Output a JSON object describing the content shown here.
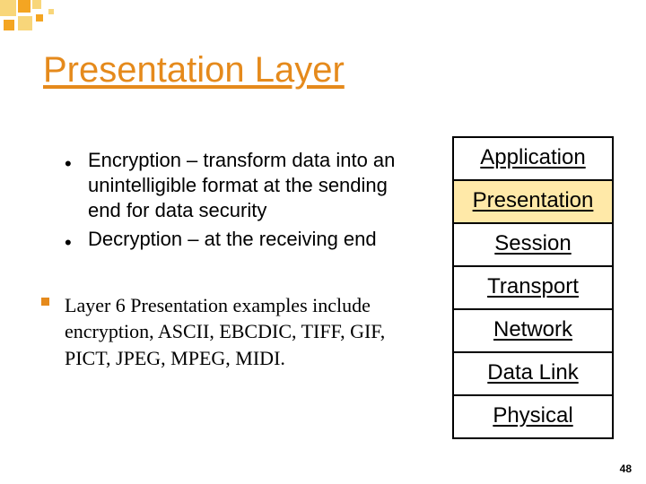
{
  "title": "Presentation Layer",
  "bullets": [
    "Encryption – transform data into an unintelligible format at the sending end for data security",
    "Decryption – at the receiving end"
  ],
  "examples_text": "Layer 6 Presentation examples include encryption, ASCII, EBCDIC, TIFF, GIF, PICT, JPEG, MPEG, MIDI.",
  "osi_layers": [
    "Application",
    "Presentation",
    "Session",
    "Transport",
    "Network",
    "Data Link",
    "Physical"
  ],
  "highlight_layer_index": 1,
  "page_number": "48",
  "colors": {
    "accent": "#e58a1c",
    "deco_orange": "#f4a522",
    "deco_yellow": "#f8d67a",
    "highlight": "#ffe9a8"
  }
}
